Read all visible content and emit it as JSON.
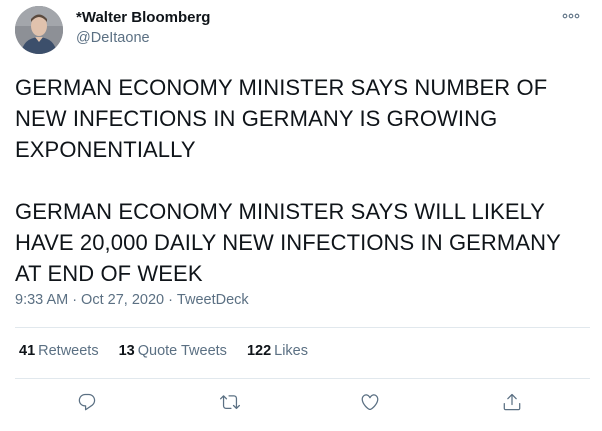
{
  "tweet": {
    "display_name": "*Walter Bloomberg",
    "handle": "@DeItaone",
    "paragraph_1": "GERMAN ECONOMY MINISTER SAYS NUMBER OF NEW INFECTIONS IN GERMANY IS GROWING EXPONENTIALLY",
    "paragraph_2": "GERMAN ECONOMY MINISTER SAYS WILL LIKELY HAVE 20,000 DAILY NEW INFECTIONS IN GERMANY AT END OF WEEK",
    "time": "9:33 AM",
    "separator": "·",
    "date": "Oct 27, 2020",
    "source": "TweetDeck"
  },
  "stats": {
    "retweets_count": "41",
    "retweets_label": "Retweets",
    "quote_count": "13",
    "quote_label": "Quote Tweets",
    "likes_count": "122",
    "likes_label": "Likes"
  },
  "icons": {
    "more": "more-dots-icon",
    "reply": "reply-icon",
    "retweet": "retweet-icon",
    "like": "like-icon",
    "share": "share-icon"
  },
  "colors": {
    "text": "#0f1419",
    "secondary": "#5b7083",
    "divider": "#e1e8ed"
  }
}
